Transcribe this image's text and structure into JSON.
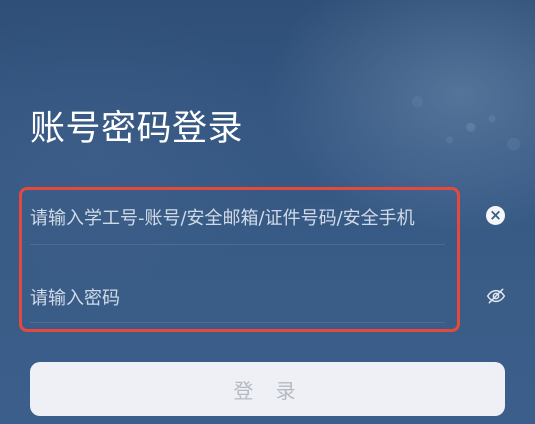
{
  "page": {
    "title": "账号密码登录"
  },
  "form": {
    "account": {
      "placeholder": "请输入学工号-账号/安全邮箱/证件号码/安全手机",
      "value": "",
      "clear_icon": "close-circle-icon"
    },
    "password": {
      "placeholder": "请输入密码",
      "value": "",
      "visibility_icon": "eye-off-icon"
    },
    "highlight_color": "#e5483d"
  },
  "actions": {
    "login_label": "登 录"
  },
  "colors": {
    "background": "#355883",
    "button_background": "#eef0f5",
    "button_text": "#b5bac2",
    "title_text": "#ffffff"
  }
}
